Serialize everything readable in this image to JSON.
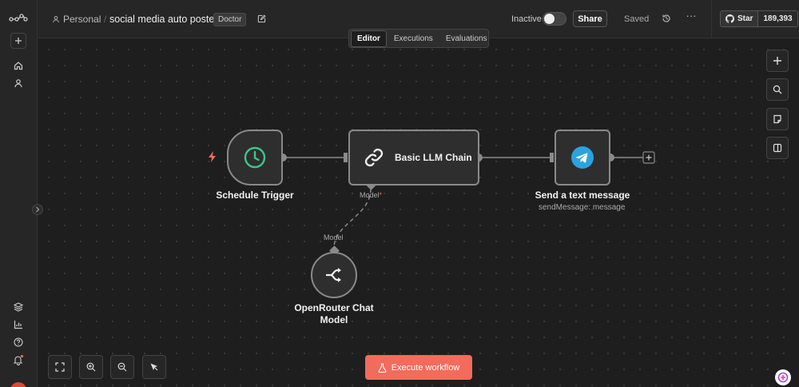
{
  "topbar": {
    "project": "Personal",
    "separator": "/",
    "workflow_name": "social media auto poster",
    "tag": "Doctor",
    "status_label": "Inactive",
    "share_label": "Share",
    "saved_label": "Saved",
    "github_star_label": "Star",
    "github_star_count": "189,393"
  },
  "tabs": [
    "Editor",
    "Executions",
    "Evaluations"
  ],
  "nodes": {
    "trigger": {
      "label": "Schedule Trigger"
    },
    "llm": {
      "label": "Basic LLM Chain",
      "connector_label": "Model",
      "required_marker": "*"
    },
    "telegram": {
      "label": "Send a text message",
      "subtitle": "sendMessage: message"
    },
    "model": {
      "label_line1": "OpenRouter Chat",
      "label_line2": "Model",
      "connector_label": "Model"
    }
  },
  "execute_button": {
    "label": "Execute workflow"
  },
  "colors": {
    "accent": "#f26b5b",
    "trigger_clock": "#3ec48b",
    "telegram": "#2aa3e0",
    "bolt": "#f26b5b"
  }
}
